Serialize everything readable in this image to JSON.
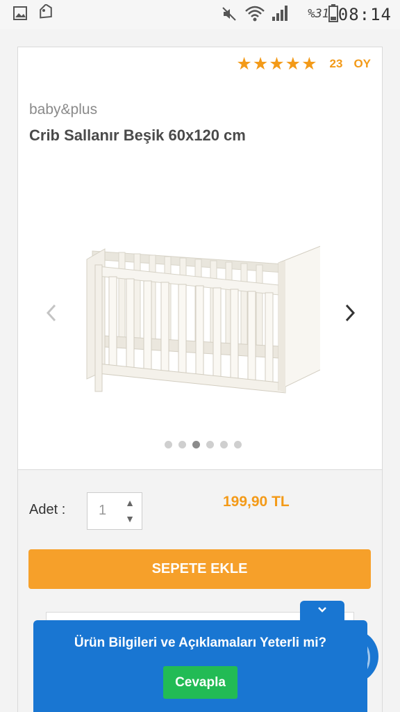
{
  "status_bar": {
    "battery_percent": "%31",
    "time": "08:14",
    "icons": [
      "gallery-icon",
      "tag-icon",
      "mute-icon",
      "wifi-icon",
      "signal-icon",
      "battery-icon"
    ]
  },
  "product": {
    "rating_stars": 5,
    "rating_count": "23",
    "rating_unit": "OY",
    "brand": "baby&plus",
    "title": "Crib Sallanır Beşik 60x120 cm",
    "gallery": {
      "slide_count": 6,
      "active_index": 2
    }
  },
  "purchase": {
    "qty_label": "Adet :",
    "qty_value": "1",
    "price": "199,90 TL",
    "add_to_cart": "SEPETE EKLE"
  },
  "feedback": {
    "question": "Ürün Bilgileri ve Açıklamaları Yeterli mi?",
    "answer_button": "Cevapla"
  },
  "colors": {
    "accent_orange": "#f39a18",
    "button_orange": "#f6a02a",
    "feedback_blue": "#1976d2",
    "answer_green": "#22bb55"
  }
}
